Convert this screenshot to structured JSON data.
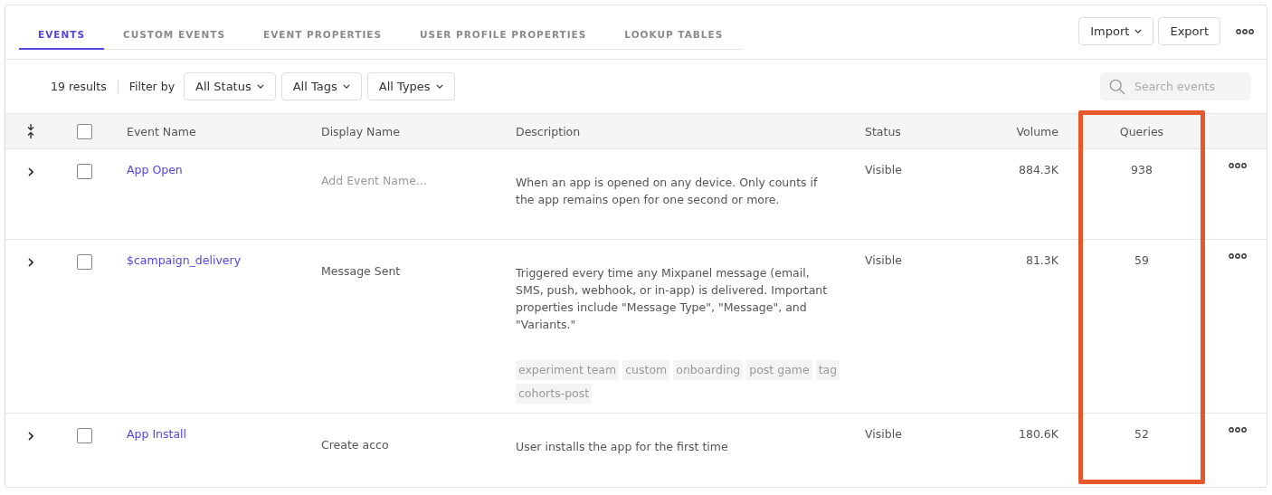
{
  "tabs": [
    {
      "label": "EVENTS",
      "selected": true
    },
    {
      "label": "CUSTOM EVENTS",
      "selected": false
    },
    {
      "label": "EVENT PROPERTIES",
      "selected": false
    },
    {
      "label": "USER PROFILE PROPERTIES",
      "selected": false
    },
    {
      "label": "LOOKUP TABLES",
      "selected": false
    }
  ],
  "actions": {
    "import": "Import",
    "export": "Export"
  },
  "filter_bar": {
    "count": "19 results",
    "filter_label": "Filter by",
    "filters": [
      "All Status",
      "All Tags",
      "All Types"
    ],
    "search": {
      "placeholder": "Search events"
    }
  },
  "table": {
    "select_all": {
      "checked": false
    },
    "columns": [
      {
        "label": "Event Name",
        "highlighted": false
      },
      {
        "label": "Display Name",
        "highlighted": false
      },
      {
        "label": "Description",
        "highlighted": false
      },
      {
        "label": "Status",
        "highlighted": false
      },
      {
        "label": "Volume",
        "highlighted": false
      },
      {
        "label": "Queries",
        "highlighted": true
      }
    ],
    "rows": [
      {
        "event_name": "App Open",
        "display_name": {
          "placeholder": "Add Event Name..."
        },
        "description": "When an app is opened on any device. Only counts if the app remains open for one second or more.",
        "tags": [],
        "status": "Visible",
        "volume": "884.3K",
        "queries": "938",
        "checked": false
      },
      {
        "event_name": "$campaign_delivery",
        "display_name": {
          "value": "Message Sent"
        },
        "description": "Triggered every time any Mixpanel message (email, SMS, push, webhook, or in-app) is delivered. Important properties include \"Message Type\", \"Message\", and \"Variants.\"",
        "tags": [
          "experiment team",
          "custom",
          "onboarding",
          "post game",
          "tag",
          "cohorts-post"
        ],
        "status": "Visible",
        "volume": "81.3K",
        "queries": "59",
        "checked": false
      },
      {
        "event_name": "App Install",
        "display_name": {
          "value": "Create acco"
        },
        "description": "User installs the app for the first time",
        "tags": [],
        "status": "Visible",
        "volume": "180.6K",
        "queries": "52",
        "checked": false
      }
    ]
  }
}
